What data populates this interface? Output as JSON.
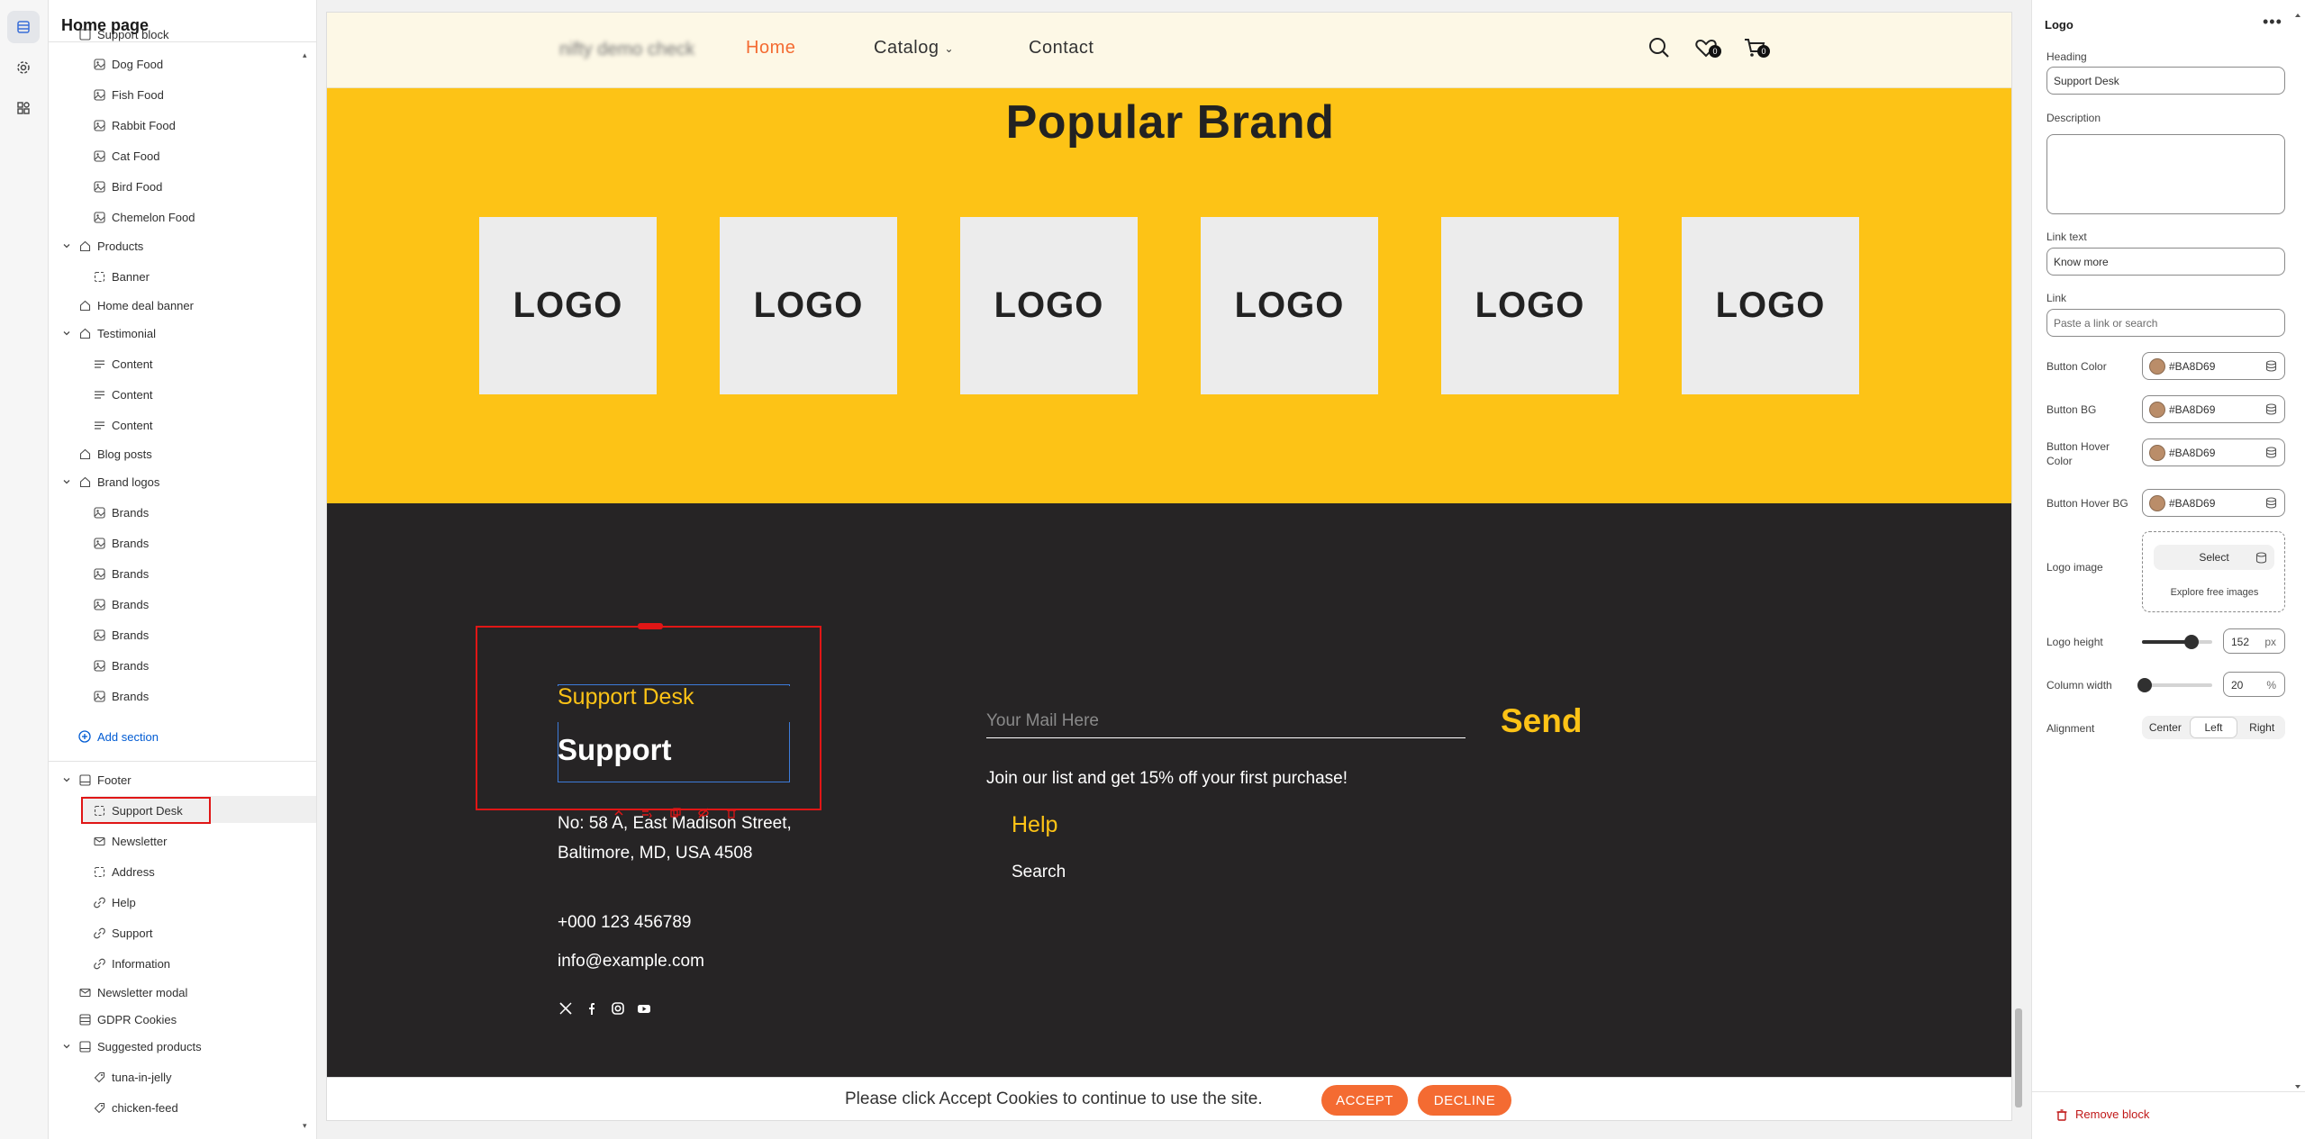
{
  "sidebar": {
    "title": "Home page",
    "items": [
      {
        "label": "Support block",
        "icon": "grid-icon",
        "level": 1
      },
      {
        "label": "Dog Food",
        "icon": "image-icon",
        "level": 2
      },
      {
        "label": "Fish Food",
        "icon": "image-icon",
        "level": 2
      },
      {
        "label": "Rabbit Food",
        "icon": "image-icon",
        "level": 2
      },
      {
        "label": "Cat Food",
        "icon": "image-icon",
        "level": 2
      },
      {
        "label": "Bird Food",
        "icon": "image-icon",
        "level": 2
      },
      {
        "label": "Chemelon Food",
        "icon": "image-icon",
        "level": 2
      },
      {
        "label": "Products",
        "icon": "section-icon",
        "level": 1
      },
      {
        "label": "Banner",
        "icon": "dashed-square-icon",
        "level": 2
      },
      {
        "label": "Home deal banner",
        "icon": "section-icon",
        "level": 1
      },
      {
        "label": "Testimonial",
        "icon": "section-icon",
        "level": 1
      },
      {
        "label": "Content",
        "icon": "text-lines-icon",
        "level": 2
      },
      {
        "label": "Content",
        "icon": "text-lines-icon",
        "level": 2
      },
      {
        "label": "Content",
        "icon": "text-lines-icon",
        "level": 2
      },
      {
        "label": "Blog posts",
        "icon": "section-icon",
        "level": 1
      },
      {
        "label": "Brand logos",
        "icon": "section-icon",
        "level": 1
      },
      {
        "label": "Brands",
        "icon": "image-icon",
        "level": 2
      },
      {
        "label": "Brands",
        "icon": "image-icon",
        "level": 2
      },
      {
        "label": "Brands",
        "icon": "image-icon",
        "level": 2
      },
      {
        "label": "Brands",
        "icon": "image-icon",
        "level": 2
      },
      {
        "label": "Brands",
        "icon": "image-icon",
        "level": 2
      },
      {
        "label": "Brands",
        "icon": "image-icon",
        "level": 2
      },
      {
        "label": "Brands",
        "icon": "image-icon",
        "level": 2
      }
    ],
    "add_section": "Add section",
    "footer_items": [
      {
        "label": "Footer",
        "icon": "footer-icon",
        "level": 1
      },
      {
        "label": "Support Desk",
        "icon": "dashed-square-icon",
        "level": 2
      },
      {
        "label": "Newsletter",
        "icon": "mail-icon",
        "level": 2
      },
      {
        "label": "Address",
        "icon": "dashed-square-icon",
        "level": 2
      },
      {
        "label": "Help",
        "icon": "link-icon",
        "level": 2
      },
      {
        "label": "Support",
        "icon": "link-icon",
        "level": 2
      },
      {
        "label": "Information",
        "icon": "link-icon",
        "level": 2
      },
      {
        "label": "Newsletter modal",
        "icon": "mail-icon",
        "level": 1
      },
      {
        "label": "GDPR Cookies",
        "icon": "cookie-icon",
        "level": 1
      },
      {
        "label": "Suggested products",
        "icon": "footer-icon",
        "level": 1
      },
      {
        "label": "tuna-in-jelly",
        "icon": "tag-icon",
        "level": 2
      },
      {
        "label": "chicken-feed",
        "icon": "tag-icon",
        "level": 2
      }
    ]
  },
  "preview": {
    "header": {
      "store_name": "nifty demo check",
      "nav": [
        "Home",
        "Catalog",
        "Contact"
      ],
      "wishlist_count": "0",
      "cart_count": "0"
    },
    "brand_section": {
      "title": "Popular Brand",
      "logos": [
        "LOGO",
        "LOGO",
        "LOGO",
        "LOGO",
        "LOGO",
        "LOGO"
      ]
    },
    "footer": {
      "support_heading": "Support Desk",
      "support_sub": "Support",
      "address_line1": "No: 58 A, East Madison Street,",
      "address_line2": "Baltimore, MD, USA 4508",
      "phone": "+000 123 456789",
      "email": "info@example.com",
      "newsletter_placeholder": "Your Mail Here",
      "send_label": "Send",
      "newsletter_text": "Join our list and get 15% off your first purchase!",
      "help_title": "Help",
      "help_links": [
        "Search"
      ]
    },
    "cookie": {
      "text": "Please click Accept Cookies to continue to use the site.",
      "accept": "ACCEPT",
      "decline": "DECLINE"
    }
  },
  "panel": {
    "title": "Logo",
    "more": "•••",
    "heading_label": "Heading",
    "heading_value": "Support Desk",
    "description_label": "Description",
    "description_value": "",
    "link_text_label": "Link text",
    "link_text_value": "Know more",
    "link_label": "Link",
    "link_placeholder": "Paste a link or search",
    "colors": [
      {
        "label": "Button Color",
        "value": "#BA8D69"
      },
      {
        "label": "Button BG",
        "value": "#BA8D69"
      },
      {
        "label": "Button Hover Color",
        "value": "#BA8D69"
      },
      {
        "label": "Button Hover BG",
        "value": "#BA8D69"
      }
    ],
    "logo_image_label": "Logo image",
    "select_label": "Select",
    "explore_label": "Explore free images",
    "logo_height_label": "Logo height",
    "logo_height_value": "152",
    "logo_height_unit": "px",
    "logo_height_fraction": 0.7,
    "column_width_label": "Column width",
    "column_width_value": "20",
    "column_width_unit": "%",
    "column_width_fraction": 0.04,
    "alignment_label": "Alignment",
    "alignment_options": [
      "Center",
      "Left",
      "Right"
    ],
    "alignment_selected": "Left",
    "remove_label": "Remove block"
  },
  "colors": {
    "accent_yellow": "#fdc316",
    "footer_bg": "#262425",
    "header_bg": "#fdf8e6",
    "nav_active": "#f46b32",
    "cookie_button": "#f46b32",
    "selection_red": "#e01616",
    "selection_blue": "#3d7bd9",
    "link_blue": "#005bd3",
    "swatch": "#ba8d69"
  }
}
